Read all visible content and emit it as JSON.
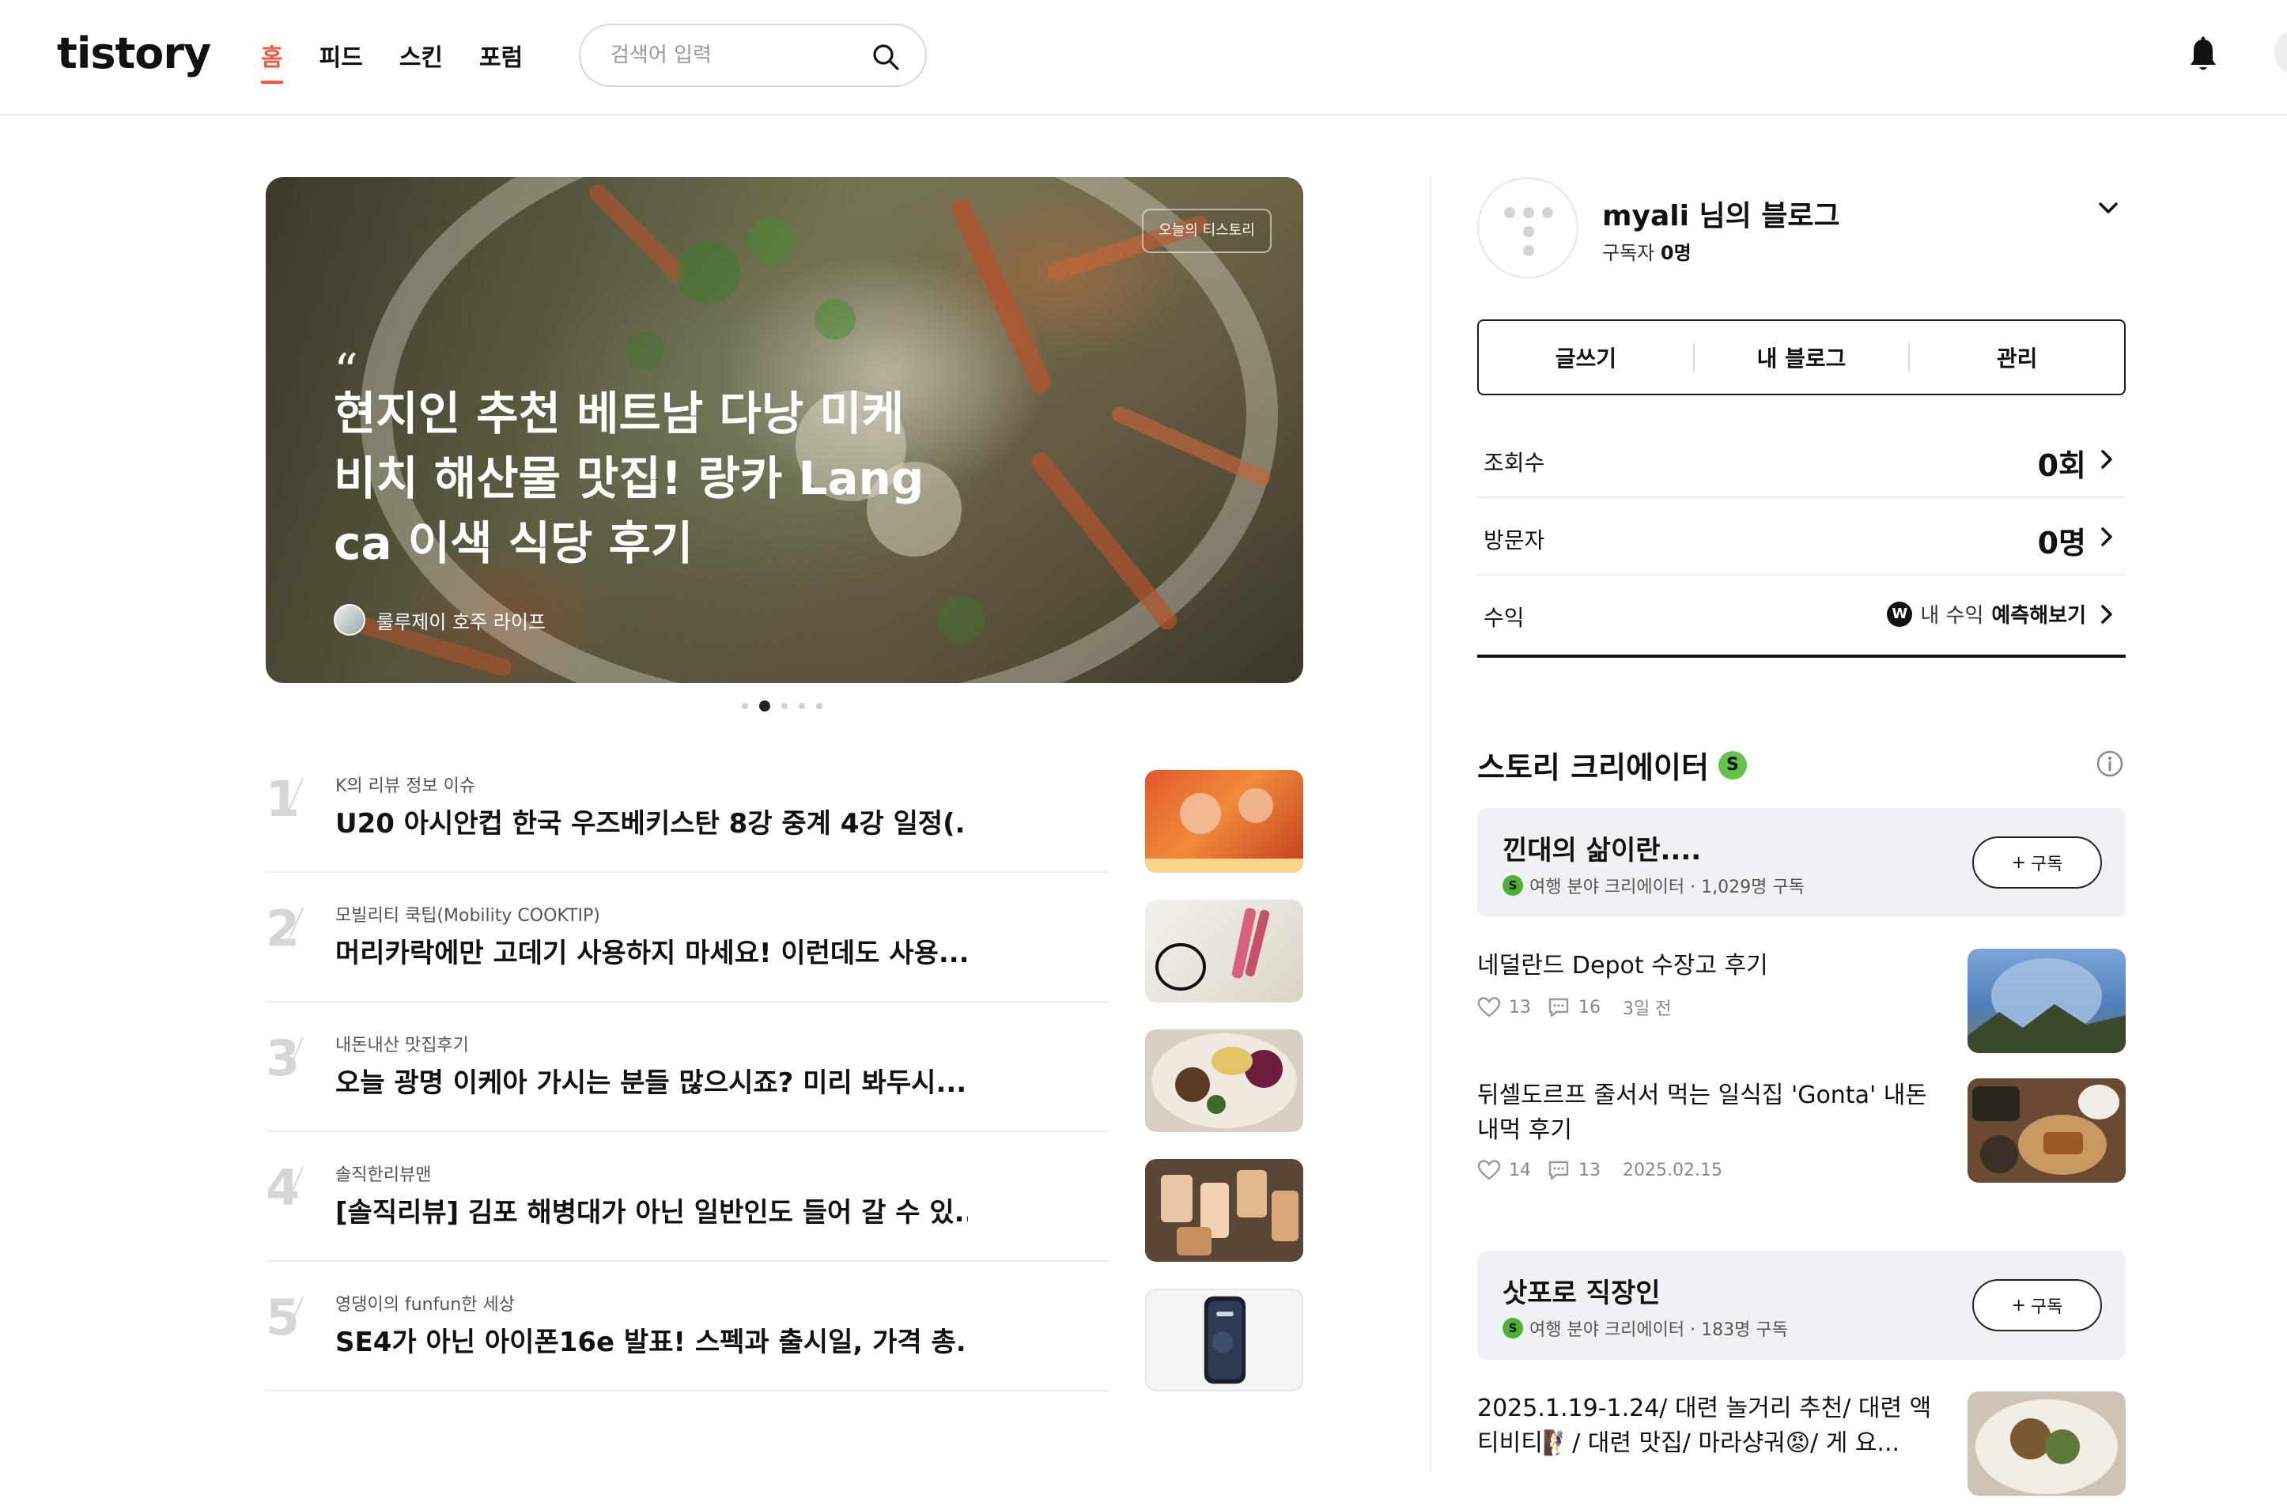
{
  "header": {
    "logo": "tistory",
    "nav": [
      "홈",
      "피드",
      "스킨",
      "포럼"
    ],
    "search_placeholder": "검색어 입력"
  },
  "hero": {
    "badge": "오늘의 티스토리",
    "quote_mark": "“",
    "title": "현지인 추천 베트남 다낭 미케비치 해산물 맛집! 랑카 Lang ca 이색 식당 후기",
    "author": "룰루제이 호주 라이프",
    "dots_count": 5,
    "active_dot": 2
  },
  "rankings": [
    {
      "num": "1",
      "category": "K의 리뷰 정보 이슈",
      "title": "U20 아시안컵 한국 우즈베키스탄 8강 중계 4강 일정(..."
    },
    {
      "num": "2",
      "category": "모빌리티 쿡팁(Mobility COOKTIP)",
      "title": "머리카락에만 고데기 사용하지 마세요! 이런데도 사용..."
    },
    {
      "num": "3",
      "category": "내돈내산 맛집후기",
      "title": "오늘 광명 이케아 가시는 분들 많으시죠? 미리 봐두시..."
    },
    {
      "num": "4",
      "category": "솔직한리뷰맨",
      "title": "[솔직리뷰] 김포 해병대가 아닌 일반인도 들어 갈 수 있..."
    },
    {
      "num": "5",
      "category": "영댕이의 funfun한 세상",
      "title": "SE4가 아닌 아이폰16e 발표! 스펙과 출시일, 가격 총..."
    }
  ],
  "profile": {
    "name": "myali 님의 블로그",
    "subscribers_label": "구독자",
    "subscribers_value": "0명",
    "buttons": [
      "글쓰기",
      "내 블로그",
      "관리"
    ],
    "stats": [
      {
        "label": "조회수",
        "value": "0회"
      },
      {
        "label": "방문자",
        "value": "0명"
      }
    ],
    "income": {
      "label": "수익",
      "link_prefix": "내 수익",
      "link_bold": "예측해보기",
      "won_symbol": "W"
    }
  },
  "story_creator": {
    "title": "스토리 크리에이터",
    "badge": "S",
    "creators": [
      {
        "name": "낀대의 삶이란....",
        "meta": "여행 분야 크리에이터 · 1,029명 구독",
        "subscribe_label": "구독",
        "posts": [
          {
            "title": "네덜란드 Depot 수장고 후기",
            "likes": "13",
            "comments": "16",
            "date": "3일 전"
          },
          {
            "title": "뒤셀도르프 줄서서 먹는 일식집 'Gonta' 내돈내먹 후기",
            "likes": "14",
            "comments": "13",
            "date": "2025.02.15"
          }
        ]
      },
      {
        "name": "삿포로 직장인",
        "meta": "여행 분야 크리에이터 · 183명 구독",
        "subscribe_label": "구독",
        "posts": [
          {
            "title": "2025.1.19-1.24/ 대련 놀거리 추천/ 대련 액티비티🧗‍♀️/ 대련 맛집/ 마라샹궈😡/ 게 요...",
            "likes": "",
            "comments": "",
            "date": ""
          }
        ]
      }
    ]
  },
  "colors": {
    "accent": "#ef5b3f",
    "creator_badge": "#64c24b",
    "card_bg": "#f0f1f4"
  }
}
